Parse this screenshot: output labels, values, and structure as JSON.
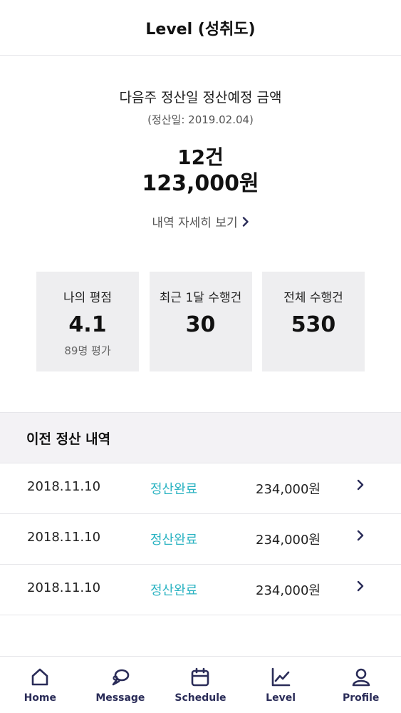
{
  "header": {
    "title": "Level (성취도)"
  },
  "summary": {
    "heading": "다음주 정산일 정산예정 금액",
    "settlement_date": "(정산일: 2019.02.04)",
    "count": "12건",
    "amount": "123,000원",
    "detail_link": "내역 자세히 보기"
  },
  "stats": [
    {
      "label": "나의 평점",
      "value": "4.1",
      "sub": "89명 평가"
    },
    {
      "label": "최근 1달 수행건",
      "value": "30",
      "sub": ""
    },
    {
      "label": "전체 수행건",
      "value": "530",
      "sub": ""
    }
  ],
  "history": {
    "title": "이전 정산 내역",
    "rows": [
      {
        "date": "2018.11.10",
        "status": "정산완료",
        "amount": "234,000원"
      },
      {
        "date": "2018.11.10",
        "status": "정산완료",
        "amount": "234,000원"
      },
      {
        "date": "2018.11.10",
        "status": "정산완료",
        "amount": "234,000원"
      }
    ]
  },
  "tabbar": {
    "items": [
      {
        "label": "Home",
        "icon": "home-icon"
      },
      {
        "label": "Message",
        "icon": "message-icon"
      },
      {
        "label": "Schedule",
        "icon": "calendar-icon"
      },
      {
        "label": "Level",
        "icon": "chart-icon"
      },
      {
        "label": "Profile",
        "icon": "user-icon"
      }
    ]
  },
  "colors": {
    "accent": "#2bb3c2",
    "tab": "#2a2c58",
    "card": "#eeeef0",
    "section": "#f3f2f5"
  }
}
